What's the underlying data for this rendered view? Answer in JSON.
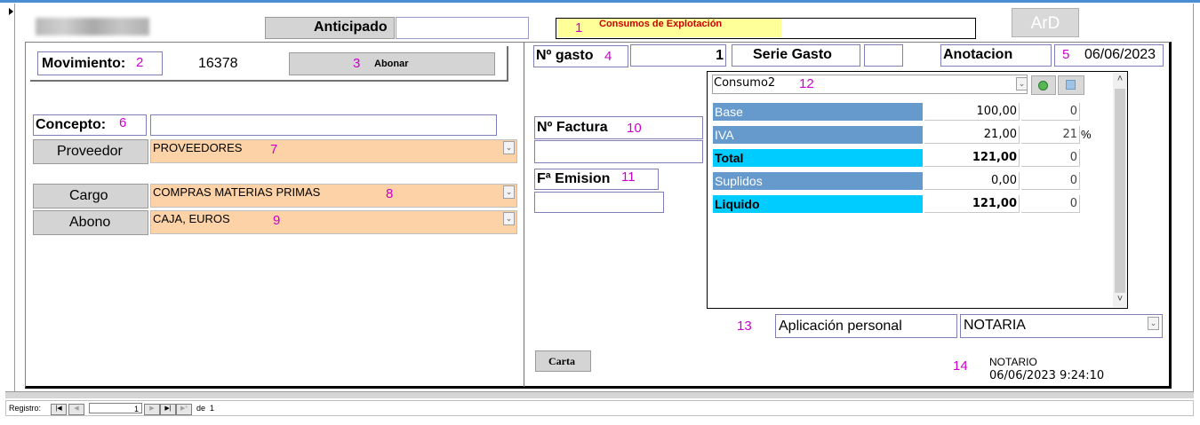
{
  "header": {
    "anticipado_label": "Anticipado",
    "consumos_label": "Consumos de Explotación",
    "ard_label": "ArD",
    "marker_1": "1"
  },
  "left": {
    "movimiento_label": "Movimiento:",
    "movimiento_marker": "2",
    "movimiento_value": "16378",
    "abonar_label": "Abonar",
    "abonar_marker": "3",
    "concepto_label": "Concepto:",
    "concepto_marker": "6",
    "concepto_value": "",
    "proveedor_button": "Proveedor",
    "proveedor_value": "PROVEEDORES",
    "proveedor_marker": "7",
    "cargo_button": "Cargo",
    "cargo_value": "COMPRAS MATERIAS PRIMAS",
    "cargo_marker": "8",
    "abono_button": "Abono",
    "abono_value": "CAJA, EUROS",
    "abono_marker": "9"
  },
  "right": {
    "ngasto_label": "Nº gasto",
    "ngasto_marker": "4",
    "ngasto_value": "1",
    "serie_label": "Serie Gasto",
    "serie_value": "",
    "anotacion_label": "Anotacion",
    "anotacion_marker": "5",
    "anotacion_value": "06/06/2023",
    "nfactura_label": "Nº Factura",
    "nfactura_marker": "10",
    "nfactura_value": "",
    "femision_label": "Fª Emision",
    "femision_marker": "11",
    "femision_value": "",
    "carta_label": "Carta",
    "aplicacion_marker": "13",
    "aplicacion_label": "Aplicación personal",
    "aplicacion_value": "NOTARIA",
    "footer_marker": "14",
    "footer_user": "NOTARIO",
    "footer_datetime": "06/06/2023 9:24:10"
  },
  "subform": {
    "combo_value": "Consumo2",
    "combo_marker": "12",
    "rows": [
      {
        "label": "Base",
        "value": "100,00",
        "extra": "0",
        "suffix": "",
        "bold": false,
        "color": "#6699cc"
      },
      {
        "label": "IVA",
        "value": "21,00",
        "extra": "21",
        "suffix": "%",
        "bold": false,
        "color": "#6699cc"
      },
      {
        "label": "Total",
        "value": "121,00",
        "extra": "0",
        "suffix": "",
        "bold": true,
        "color": "#00ccff"
      },
      {
        "label": "Suplidos",
        "value": "0,00",
        "extra": "0",
        "suffix": "",
        "bold": false,
        "color": "#6699cc"
      },
      {
        "label": "Liquido",
        "value": "121,00",
        "extra": "0",
        "suffix": "",
        "bold": true,
        "color": "#00ccff"
      }
    ]
  },
  "status": {
    "registro_label": "Registro:",
    "current_record": "1",
    "de_label": "de",
    "total_records": "1"
  },
  "colors": {
    "marker": "#cc00cc",
    "orange_field": "#fcd2a6",
    "accent_blue": "#4a8fd6"
  }
}
